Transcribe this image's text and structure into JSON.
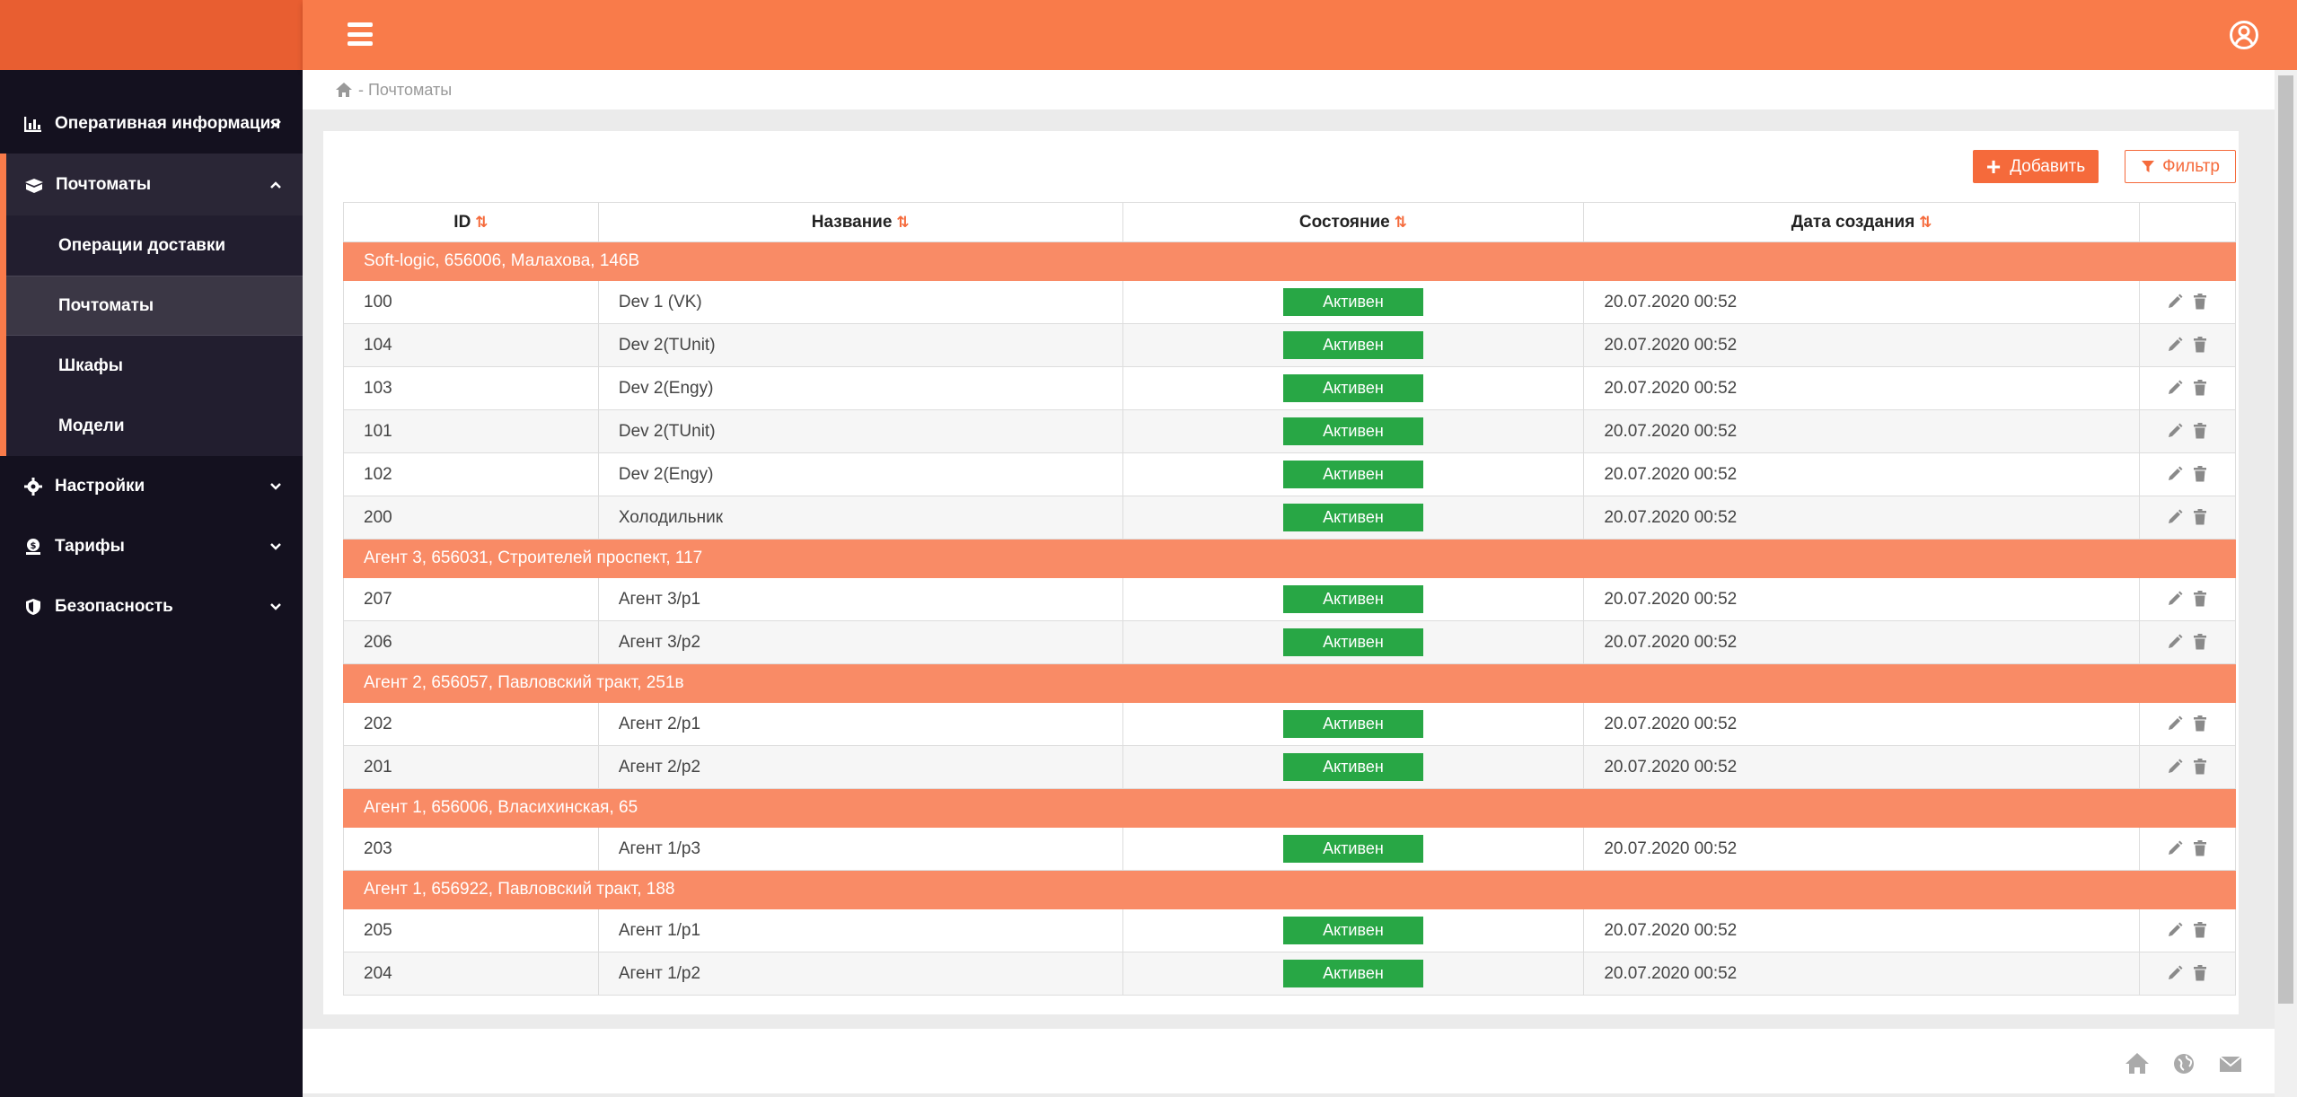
{
  "colors": {
    "accent": "#f97b4a",
    "sidebar": "#14111f",
    "success": "#28a745",
    "group_row": "#f98b66"
  },
  "sidebar": {
    "items": [
      {
        "label": "Оперативная информация",
        "icon": "chart-icon"
      },
      {
        "label": "Почтоматы",
        "icon": "boxes-icon",
        "expanded": true,
        "children": [
          "Операции доставки",
          "Почтоматы",
          "Шкафы",
          "Модели"
        ]
      },
      {
        "label": "Настройки",
        "icon": "gear-icon"
      },
      {
        "label": "Тарифы",
        "icon": "money-icon"
      },
      {
        "label": "Безопасность",
        "icon": "shield-icon"
      }
    ]
  },
  "header": {
    "menu_icon": "hamburger-icon",
    "user_icon": "user-circle-icon"
  },
  "breadcrumb": {
    "home_icon": "home-icon",
    "text": " - Почтоматы"
  },
  "toolbar": {
    "add_label": "Добавить",
    "filter_label": "Фильтр"
  },
  "table": {
    "headers": [
      "ID",
      "Название",
      "Состояние",
      "Дата создания"
    ],
    "sort_glyph": "⇅",
    "groups": [
      {
        "title": "Soft-logic, 656006, Малахова, 146В",
        "rows": [
          {
            "id": "100",
            "name": "Dev 1 (VK)",
            "status": "Активен",
            "date": "20.07.2020 00:52"
          },
          {
            "id": "104",
            "name": "Dev 2(TUnit)",
            "status": "Активен",
            "date": "20.07.2020 00:52"
          },
          {
            "id": "103",
            "name": "Dev 2(Engy)",
            "status": "Активен",
            "date": "20.07.2020 00:52"
          },
          {
            "id": "101",
            "name": "Dev 2(TUnit)",
            "status": "Активен",
            "date": "20.07.2020 00:52"
          },
          {
            "id": "102",
            "name": "Dev 2(Engy)",
            "status": "Активен",
            "date": "20.07.2020 00:52"
          },
          {
            "id": "200",
            "name": "Холодильник",
            "status": "Активен",
            "date": "20.07.2020 00:52"
          }
        ]
      },
      {
        "title": "Агент 3, 656031, Строителей проспект, 117",
        "rows": [
          {
            "id": "207",
            "name": "Агент 3/p1",
            "status": "Активен",
            "date": "20.07.2020 00:52"
          },
          {
            "id": "206",
            "name": "Агент 3/p2",
            "status": "Активен",
            "date": "20.07.2020 00:52"
          }
        ]
      },
      {
        "title": "Агент 2, 656057, Павловский тракт, 251в",
        "rows": [
          {
            "id": "202",
            "name": "Агент 2/p1",
            "status": "Активен",
            "date": "20.07.2020 00:52"
          },
          {
            "id": "201",
            "name": "Агент 2/p2",
            "status": "Активен",
            "date": "20.07.2020 00:52"
          }
        ]
      },
      {
        "title": "Агент 1, 656006, Власихинская, 65",
        "rows": [
          {
            "id": "203",
            "name": "Агент 1/p3",
            "status": "Активен",
            "date": "20.07.2020 00:52"
          }
        ]
      },
      {
        "title": "Агент 1, 656922, Павловский тракт, 188",
        "rows": [
          {
            "id": "205",
            "name": "Агент 1/p1",
            "status": "Активен",
            "date": "20.07.2020 00:52"
          },
          {
            "id": "204",
            "name": "Агент 1/p2",
            "status": "Активен",
            "date": "20.07.2020 00:52"
          }
        ]
      }
    ]
  },
  "footer": {
    "icons": [
      "home-icon",
      "globe-icon",
      "mail-icon"
    ]
  }
}
